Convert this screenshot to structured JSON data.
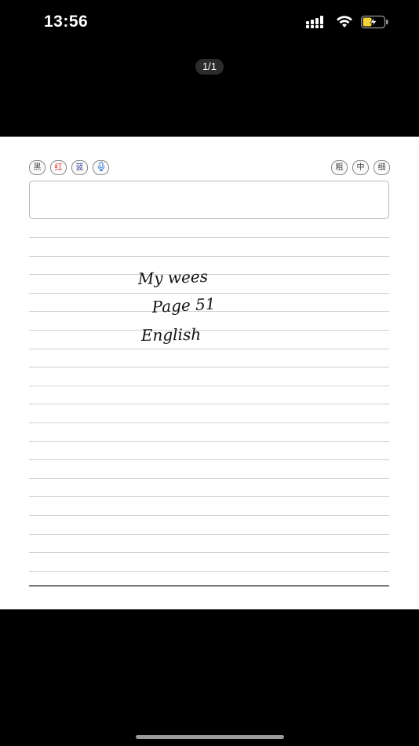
{
  "status_bar": {
    "time": "13:56",
    "battery_color": "#f4d23c"
  },
  "page_counter": "1/1",
  "toolbar": {
    "colors": [
      {
        "label": "黑",
        "color": "#444444"
      },
      {
        "label": "红",
        "color": "#d2362c"
      },
      {
        "label": "蓝",
        "color": "#33408f"
      }
    ],
    "voice_icon": "microphone-icon",
    "widths": [
      "粗",
      "中",
      "细"
    ]
  },
  "text_input": {
    "value": ""
  },
  "handwriting": {
    "lines": [
      "My wees",
      "Page 51",
      "English"
    ]
  }
}
